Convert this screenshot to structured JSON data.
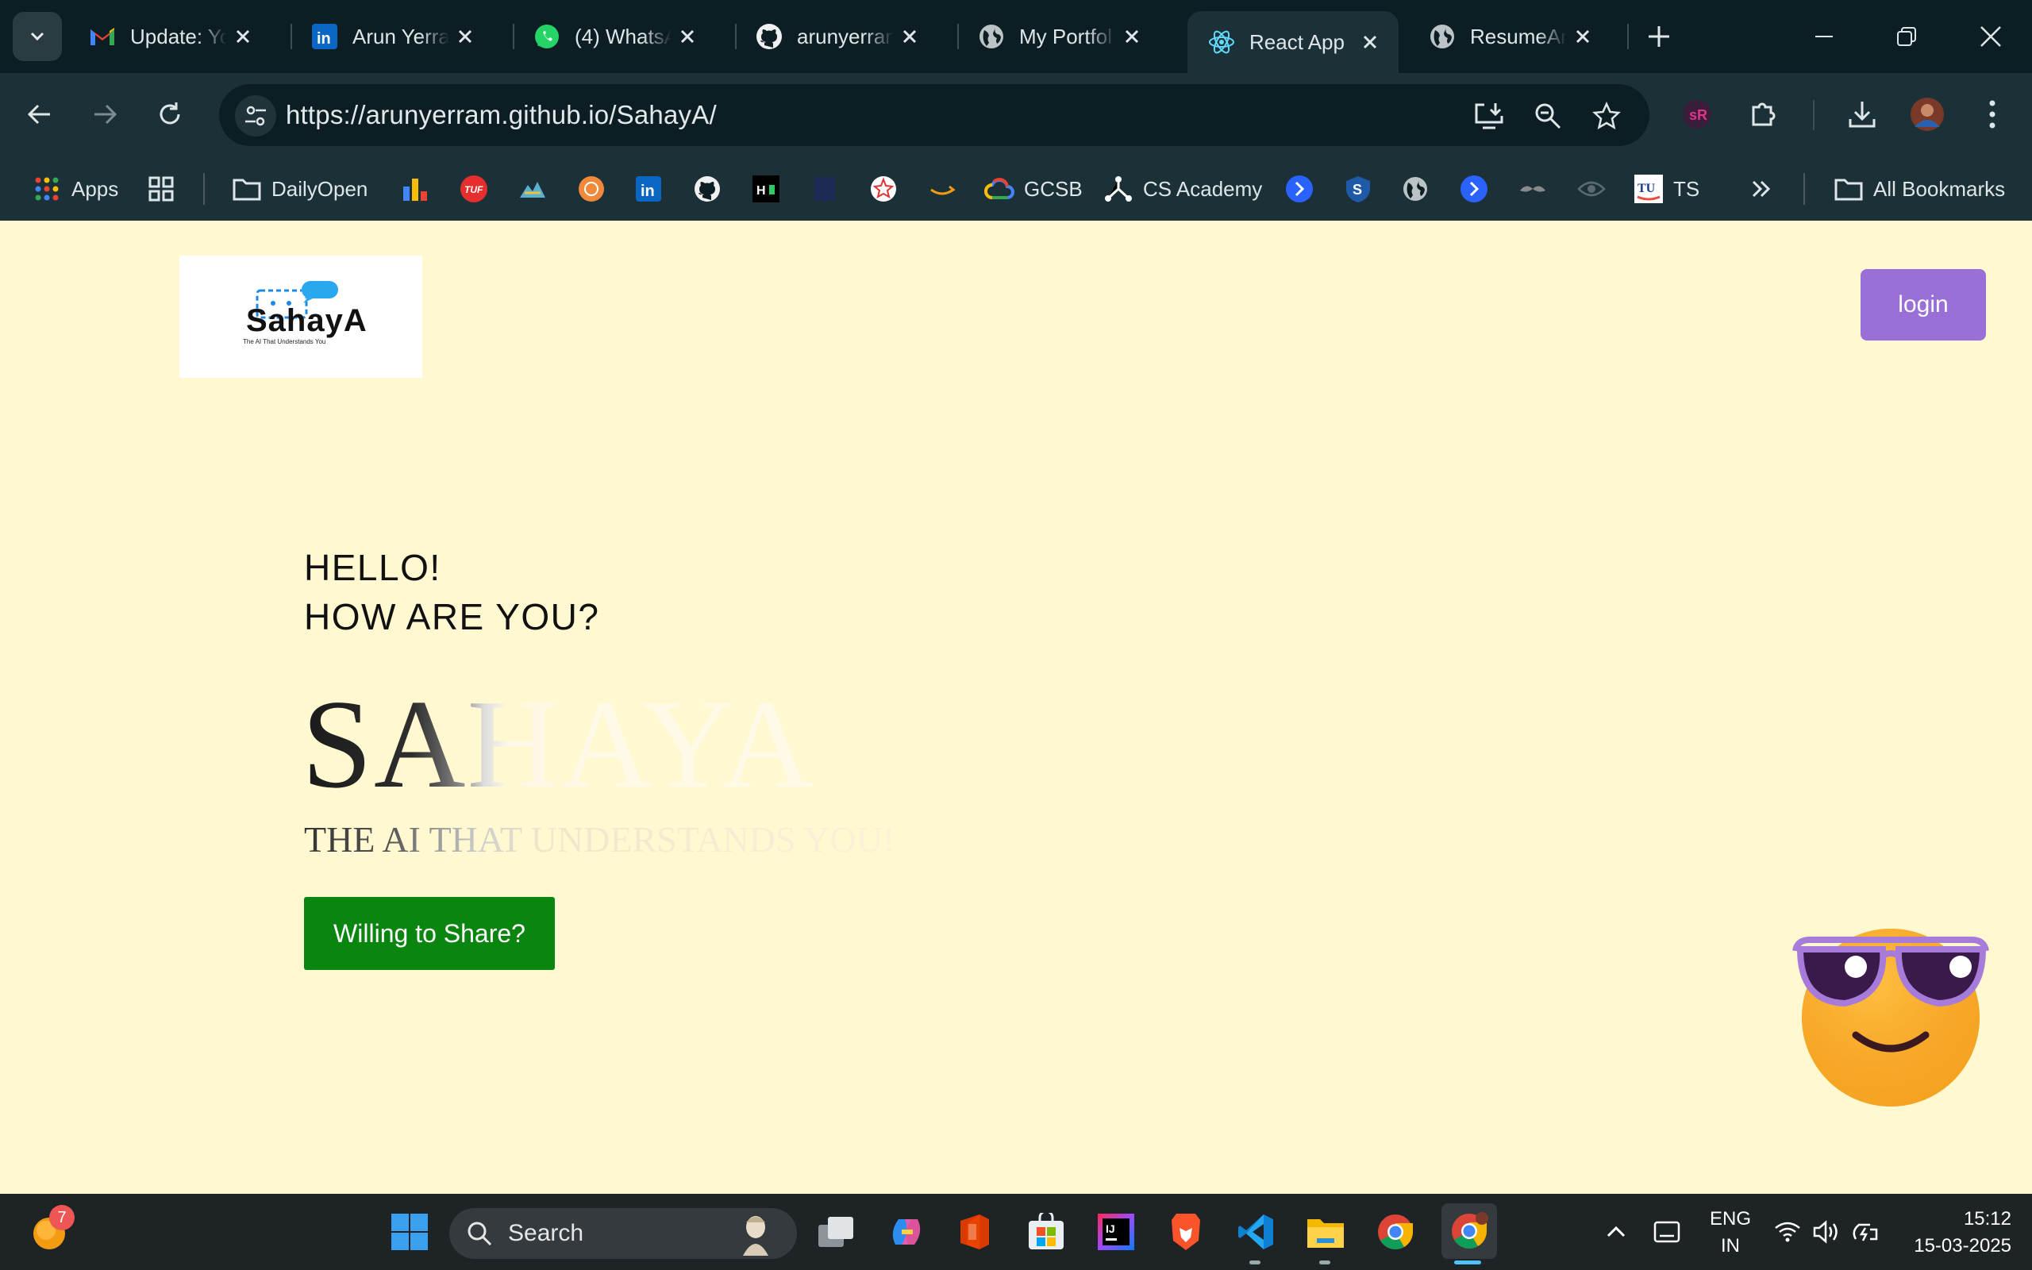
{
  "browser": {
    "tabs": [
      {
        "title": "Update: Yo",
        "icon": "gmail-icon"
      },
      {
        "title": "Arun Yerra",
        "icon": "linkedin-icon"
      },
      {
        "title": "(4) WhatsA",
        "icon": "whatsapp-icon"
      },
      {
        "title": "arunyerran",
        "icon": "github-icon"
      },
      {
        "title": "My Portfol",
        "icon": "globe-icon"
      },
      {
        "title": "React App",
        "icon": "react-icon",
        "active": true
      },
      {
        "title": "ResumeAn",
        "icon": "globe-icon"
      }
    ],
    "url": "https://arunyerram.github.io/SahayA/",
    "bookmarks": {
      "apps_label": "Apps",
      "dailyopen_label": "DailyOpen",
      "gcsb_label": "GCSB",
      "csacademy_label": "CS Academy",
      "ts_label": "TS",
      "all_label": "All Bookmarks"
    }
  },
  "page": {
    "logo_text": "SahayA",
    "logo_subtext": "The AI That Understands You",
    "login_label": "login",
    "greeting_line1": "HELLO!",
    "greeting_line2": "HOW ARE YOU?",
    "hero_title": "SAHAYA",
    "tagline": "THE AI THAT UNDERSTANDS YOU!",
    "share_button": "Willing to Share?"
  },
  "taskbar": {
    "widget_badge": "7",
    "search_label": "Search",
    "language_line1": "ENG",
    "language_line2": "IN",
    "time": "15:12",
    "date": "15-03-2025"
  }
}
